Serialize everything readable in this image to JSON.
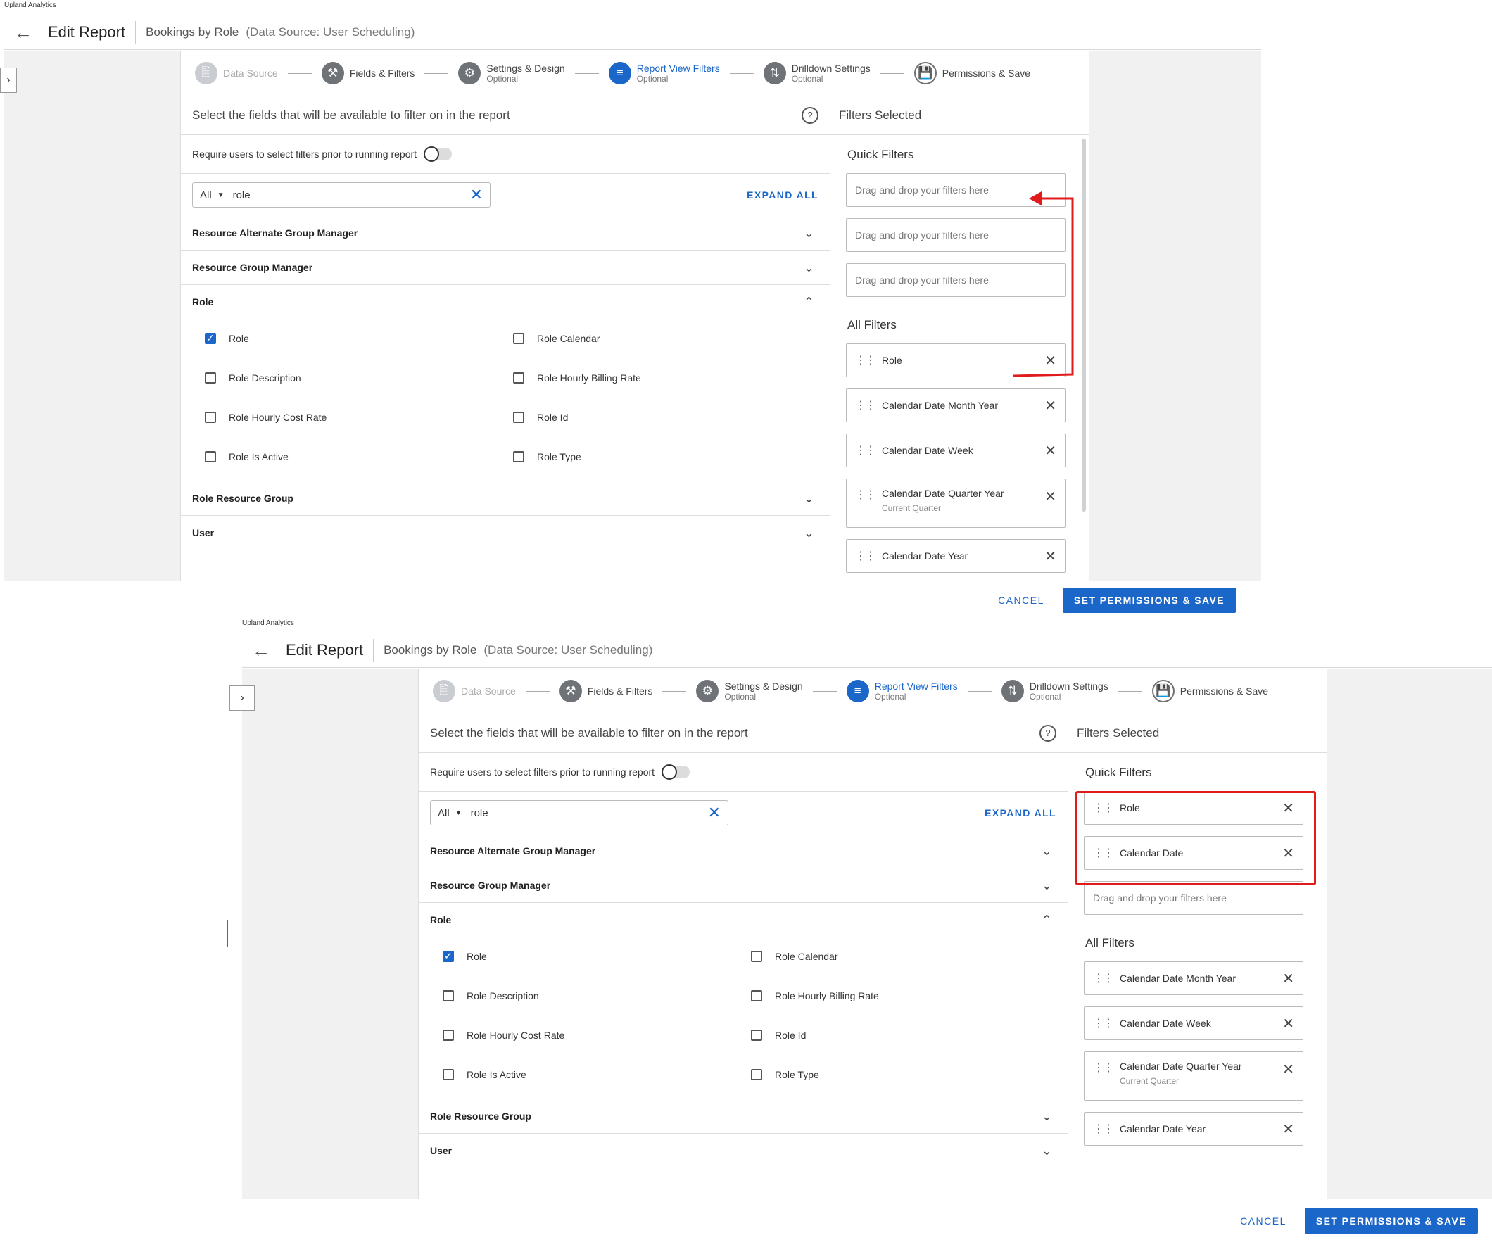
{
  "brand": "Upland Analytics",
  "header": {
    "title": "Edit Report",
    "report_name": "Bookings by Role",
    "data_source": "(Data Source: User Scheduling)"
  },
  "collapse_icon": "chevron-right-icon",
  "steps": [
    {
      "label": "Data Source",
      "sub": "",
      "icon": "folder-icon"
    },
    {
      "label": "Fields & Filters",
      "sub": "",
      "icon": "tools-icon"
    },
    {
      "label": "Settings & Design",
      "sub": "Optional",
      "icon": "gear-icon"
    },
    {
      "label": "Report View Filters",
      "sub": "Optional",
      "icon": "filter-icon"
    },
    {
      "label": "Drilldown Settings",
      "sub": "Optional",
      "icon": "sort-icon"
    },
    {
      "label": "Permissions & Save",
      "sub": "",
      "icon": "save-icon"
    }
  ],
  "left": {
    "heading": "Select the fields that will be available to filter on in the report",
    "require_label": "Require users to select filters prior to running report",
    "search_scope": "All",
    "search_value": "role",
    "expand_all": "EXPAND ALL",
    "groups": [
      "Resource Alternate Group Manager",
      "Resource Group Manager",
      "Role",
      "Role Resource Group",
      "User"
    ],
    "role_fields": [
      "Role",
      "Role Calendar",
      "Role Description",
      "Role Hourly Billing Rate",
      "Role Hourly Cost Rate",
      "Role Id",
      "Role Is Active",
      "Role Type"
    ]
  },
  "right": {
    "heading": "Filters Selected",
    "quick_title": "Quick Filters",
    "all_title": "All Filters",
    "drop_placeholder": "Drag and drop your filters here",
    "quick_after": [
      "Role",
      "Calendar Date"
    ],
    "all_before": [
      {
        "label": "Role",
        "sub": ""
      },
      {
        "label": "Calendar Date Month Year",
        "sub": ""
      },
      {
        "label": "Calendar Date Week",
        "sub": ""
      },
      {
        "label": "Calendar Date Quarter Year",
        "sub": "Current Quarter"
      },
      {
        "label": "Calendar Date Year",
        "sub": ""
      }
    ],
    "all_after": [
      {
        "label": "Calendar Date Month Year",
        "sub": ""
      },
      {
        "label": "Calendar Date Week",
        "sub": ""
      },
      {
        "label": "Calendar Date Quarter Year",
        "sub": "Current Quarter"
      },
      {
        "label": "Calendar Date Year",
        "sub": ""
      }
    ]
  },
  "footer": {
    "cancel": "CANCEL",
    "save": "SET PERMISSIONS & SAVE"
  },
  "colors": {
    "accent": "#1a66c9",
    "annotation": "#e01b1b"
  }
}
